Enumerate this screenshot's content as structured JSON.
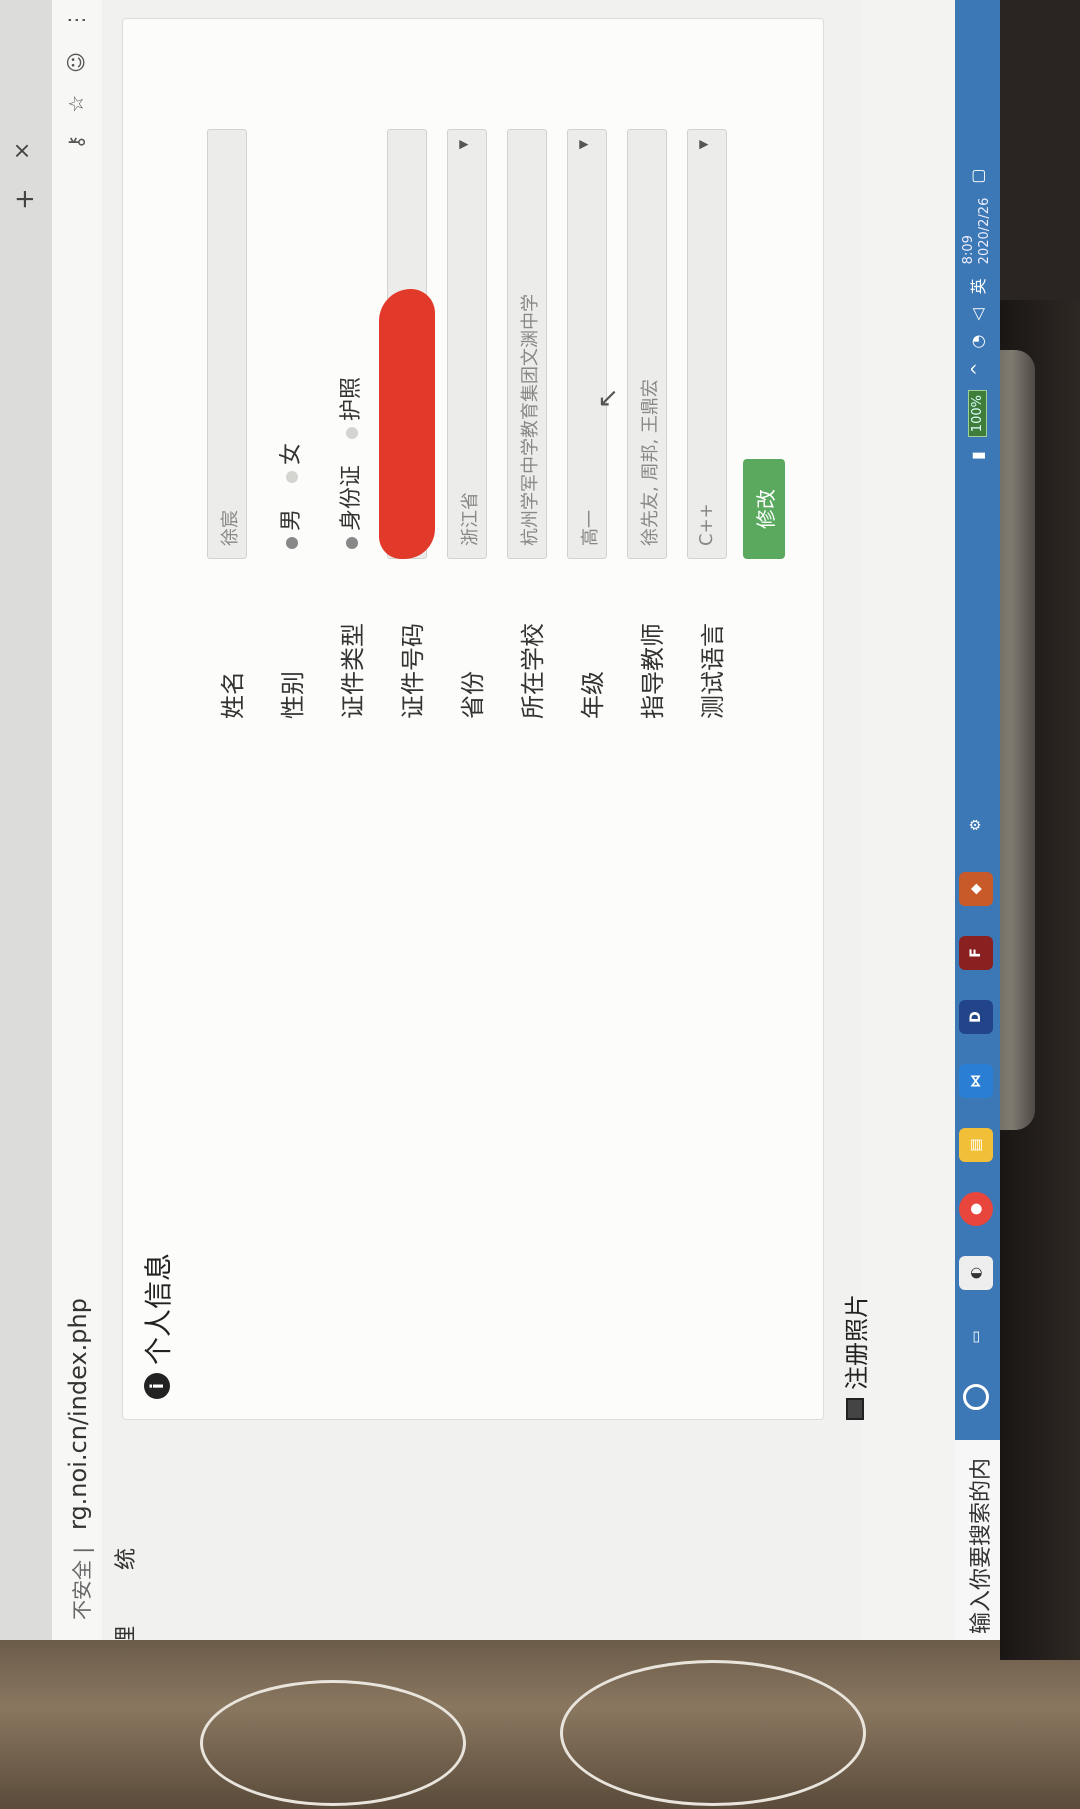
{
  "browser": {
    "security_label": "不安全 |",
    "url": "rg.noi.cn/index.php",
    "tab_close": "×",
    "new_tab": "+"
  },
  "sidebar_fragments": {
    "item1": "理",
    "item2": "统"
  },
  "panel": {
    "title": "个人信息",
    "fields": {
      "name": {
        "label": "姓名",
        "value": "徐宸"
      },
      "gender": {
        "label": "性别",
        "options": [
          "男",
          "女"
        ],
        "selected": "男"
      },
      "id_type": {
        "label": "证件类型",
        "options": [
          "身份证",
          "护照"
        ],
        "selected": "身份证"
      },
      "id_number": {
        "label": "证件号码"
      },
      "province": {
        "label": "省份",
        "value": "浙江省"
      },
      "school": {
        "label": "所在学校",
        "value": "杭州学军中学教育集团文渊中学"
      },
      "grade": {
        "label": "年级",
        "value": "高一"
      },
      "teacher": {
        "label": "指导教师",
        "value": "徐先友, 周邦, 王鼎宏"
      },
      "language": {
        "label": "测试语言",
        "value": "C++"
      }
    },
    "submit_label": "修改"
  },
  "photo_section": {
    "title": "注册照片"
  },
  "search": {
    "placeholder": "输入你要搜索的内容"
  },
  "taskbar": {
    "battery": "100%",
    "ime": "英",
    "time": "8:09",
    "date": "2020/2/26",
    "apps": [
      "cortana-icon",
      "task-view-icon",
      "app-icon",
      "chrome-icon",
      "explorer-icon",
      "vs-icon",
      "dev-cpp-icon",
      "fl-icon",
      "game-icon",
      "settings-icon"
    ]
  },
  "colors": {
    "submit_green": "#5aa95f",
    "taskbar_blue": "#3c78b5",
    "redaction_red": "#e23a2a"
  }
}
